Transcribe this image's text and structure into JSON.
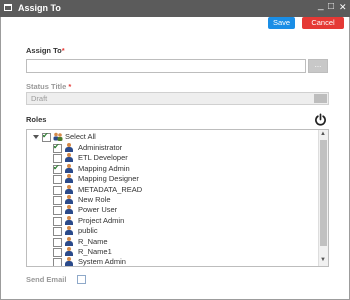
{
  "window": {
    "title": "Assign To",
    "minimize_glyph": "_",
    "maximize_glyph": "□",
    "close_glyph": "✕"
  },
  "toolbar": {
    "save_label": "Save",
    "cancel_label": "Cancel"
  },
  "assign_to": {
    "label": "Assign To",
    "required_mark": "*",
    "value": "",
    "browse_glyph": "..."
  },
  "status": {
    "label": "Status Title",
    "required_mark": "*",
    "value": "Draft"
  },
  "roles": {
    "label": "Roles",
    "select_all": {
      "label": "Select All",
      "checked": true
    },
    "items": [
      {
        "label": "Administrator",
        "checked": true
      },
      {
        "label": "ETL Developer",
        "checked": false
      },
      {
        "label": "Mapping Admin",
        "checked": true
      },
      {
        "label": "Mapping Designer",
        "checked": false
      },
      {
        "label": "METADATA_READ",
        "checked": false
      },
      {
        "label": "New Role",
        "checked": false
      },
      {
        "label": "Power User",
        "checked": false
      },
      {
        "label": "Project Admin",
        "checked": false
      },
      {
        "label": "public",
        "checked": false
      },
      {
        "label": "R_Name",
        "checked": false
      },
      {
        "label": "R_Name1",
        "checked": false
      },
      {
        "label": "System Admin",
        "checked": false
      }
    ]
  },
  "send_email": {
    "label": "Send Email",
    "checked": false
  },
  "colors": {
    "title_bar": "#5b5b5b",
    "save": "#1a8ee6",
    "cancel": "#e53935",
    "required": "#e53935"
  }
}
